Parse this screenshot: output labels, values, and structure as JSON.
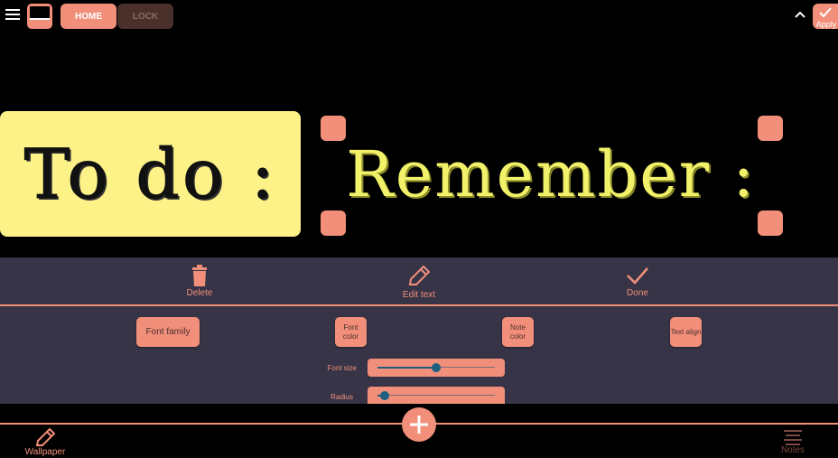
{
  "header": {
    "tabs": [
      {
        "label": "HOME",
        "active": true
      },
      {
        "label": "LOCK",
        "active": false
      }
    ],
    "apply_label": "Apply",
    "menu_icon": "hamburger-menu-icon",
    "collapse_icon": "chevron-up-icon"
  },
  "canvas": {
    "notes": [
      {
        "text": "To do :",
        "background": "#fdf287",
        "color": "#111111"
      },
      {
        "text": "Remember :",
        "background": "transparent",
        "color": "#f2f26a"
      }
    ]
  },
  "editor": {
    "actions": [
      {
        "label": "Delete",
        "icon": "trash-icon"
      },
      {
        "label": "Edit text",
        "icon": "pencil-icon"
      },
      {
        "label": "Done",
        "icon": "check-icon"
      }
    ],
    "options": [
      {
        "label": "Font family"
      },
      {
        "label": "Font color"
      },
      {
        "label": "Note color"
      },
      {
        "label": "Text align"
      }
    ],
    "sliders": [
      {
        "label": "Font size",
        "value": 0.5
      },
      {
        "label": "Radius",
        "value": 0.06
      }
    ]
  },
  "bottom_nav": {
    "items": [
      {
        "label": "Wallpaper",
        "icon": "pencil-icon",
        "active": true
      },
      {
        "label": "Notes",
        "icon": "notes-icon",
        "active": false
      }
    ],
    "fab_icon": "plus-icon"
  },
  "colors": {
    "accent": "#f28f7a",
    "panel": "#363446",
    "slider_thumb": "#1b5f7f"
  }
}
